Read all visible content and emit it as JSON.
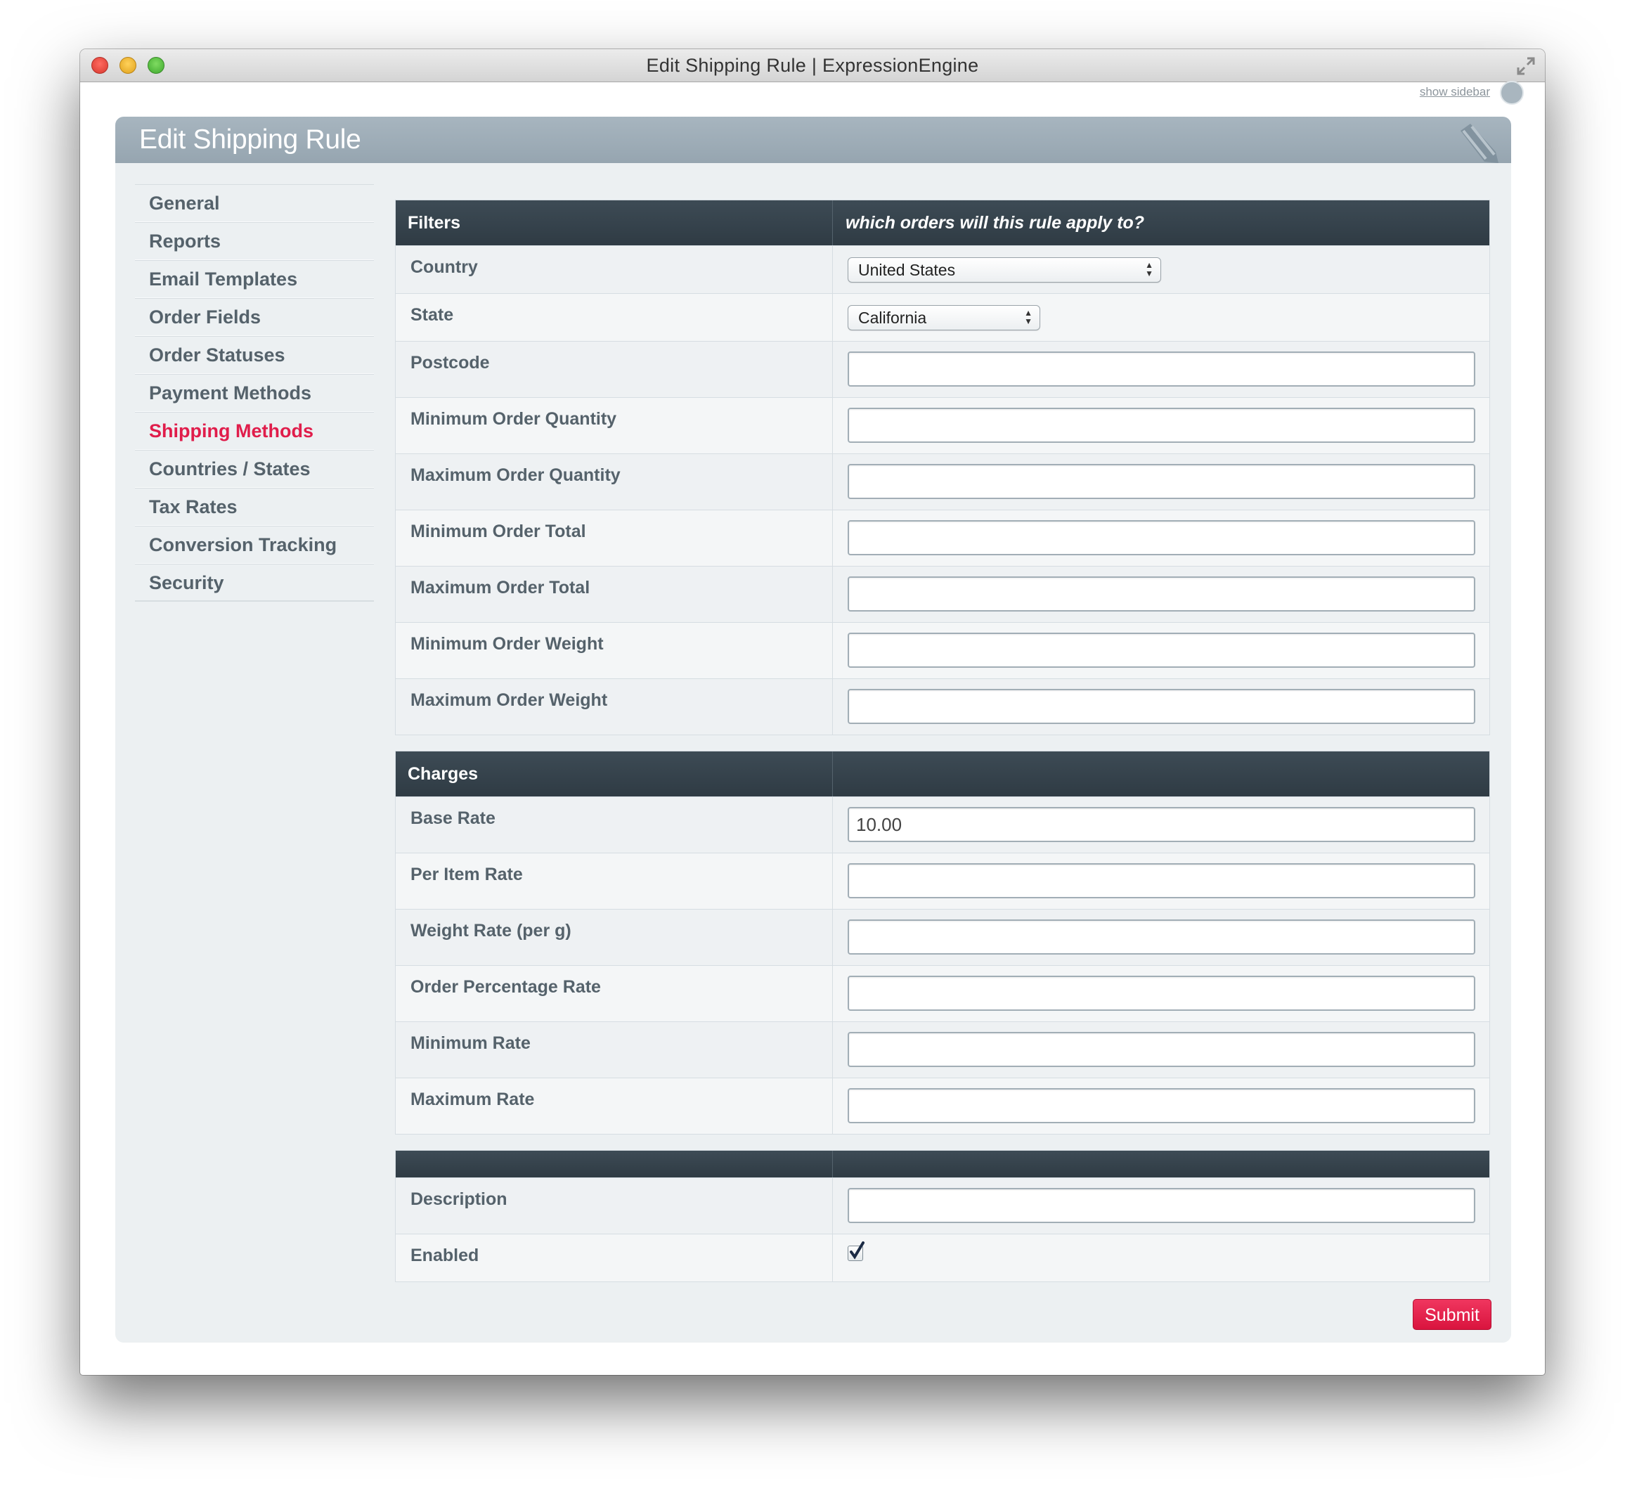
{
  "window": {
    "title": "Edit Shipping Rule | ExpressionEngine"
  },
  "topbar": {
    "show_sidebar": "show sidebar"
  },
  "panel": {
    "title": "Edit Shipping Rule"
  },
  "nav": {
    "items": [
      {
        "label": "General"
      },
      {
        "label": "Reports"
      },
      {
        "label": "Email Templates"
      },
      {
        "label": "Order Fields"
      },
      {
        "label": "Order Statuses"
      },
      {
        "label": "Payment Methods"
      },
      {
        "label": "Shipping Methods",
        "active": true
      },
      {
        "label": "Countries / States"
      },
      {
        "label": "Tax Rates"
      },
      {
        "label": "Conversion Tracking"
      },
      {
        "label": "Security"
      }
    ]
  },
  "filters": {
    "heading": "Filters",
    "subheading": "which orders will this rule apply to?",
    "country": {
      "label": "Country",
      "value": "United States"
    },
    "state": {
      "label": "State",
      "value": "California"
    },
    "postcode": {
      "label": "Postcode",
      "value": ""
    },
    "min_qty": {
      "label": "Minimum Order Quantity",
      "value": ""
    },
    "max_qty": {
      "label": "Maximum Order Quantity",
      "value": ""
    },
    "min_total": {
      "label": "Minimum Order Total",
      "value": ""
    },
    "max_total": {
      "label": "Maximum Order Total",
      "value": ""
    },
    "min_weight": {
      "label": "Minimum Order Weight",
      "value": ""
    },
    "max_weight": {
      "label": "Maximum Order Weight",
      "value": ""
    }
  },
  "charges": {
    "heading": "Charges",
    "base_rate": {
      "label": "Base Rate",
      "value": "10.00"
    },
    "per_item_rate": {
      "label": "Per Item Rate",
      "value": ""
    },
    "weight_rate": {
      "label": "Weight Rate (per g)",
      "value": ""
    },
    "order_pct_rate": {
      "label": "Order Percentage Rate",
      "value": ""
    },
    "min_rate": {
      "label": "Minimum Rate",
      "value": ""
    },
    "max_rate": {
      "label": "Maximum Rate",
      "value": ""
    }
  },
  "other": {
    "description": {
      "label": "Description",
      "value": ""
    },
    "enabled": {
      "label": "Enabled",
      "checked": true
    }
  },
  "submit_label": "Submit",
  "colors": {
    "accent": "#e01d4b",
    "header_dark": "#35434d",
    "panel_header": "#9eacb7"
  }
}
